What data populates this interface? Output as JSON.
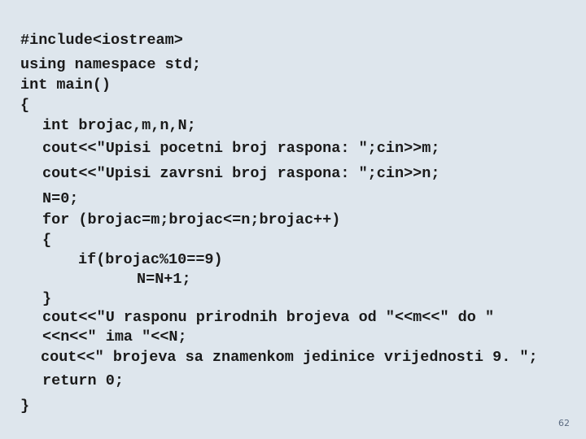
{
  "slide": {
    "code_lines": [
      "#include<iostream>",
      "using namespace std;",
      "int main()",
      "{",
      "int brojac,m,n,N;",
      "cout<<\"Upisi pocetni broj raspona: \";cin>>m;",
      "cout<<\"Upisi zavrsni broj raspona: \";cin>>n;",
      "N=0;",
      "for (brojac=m;brojac<=n;brojac++)",
      "{",
      "if(brojac%10==9)",
      "N=N+1;",
      "}",
      "cout<<\"U rasponu prirodnih brojeva od \"<<m<<\" do \"",
      "<<n<<\" ima \"<<N;",
      "cout<<\" brojeva sa znamenkom jedinice vrijednosti 9. \";",
      "return 0;",
      "}"
    ],
    "page_number": "62"
  }
}
